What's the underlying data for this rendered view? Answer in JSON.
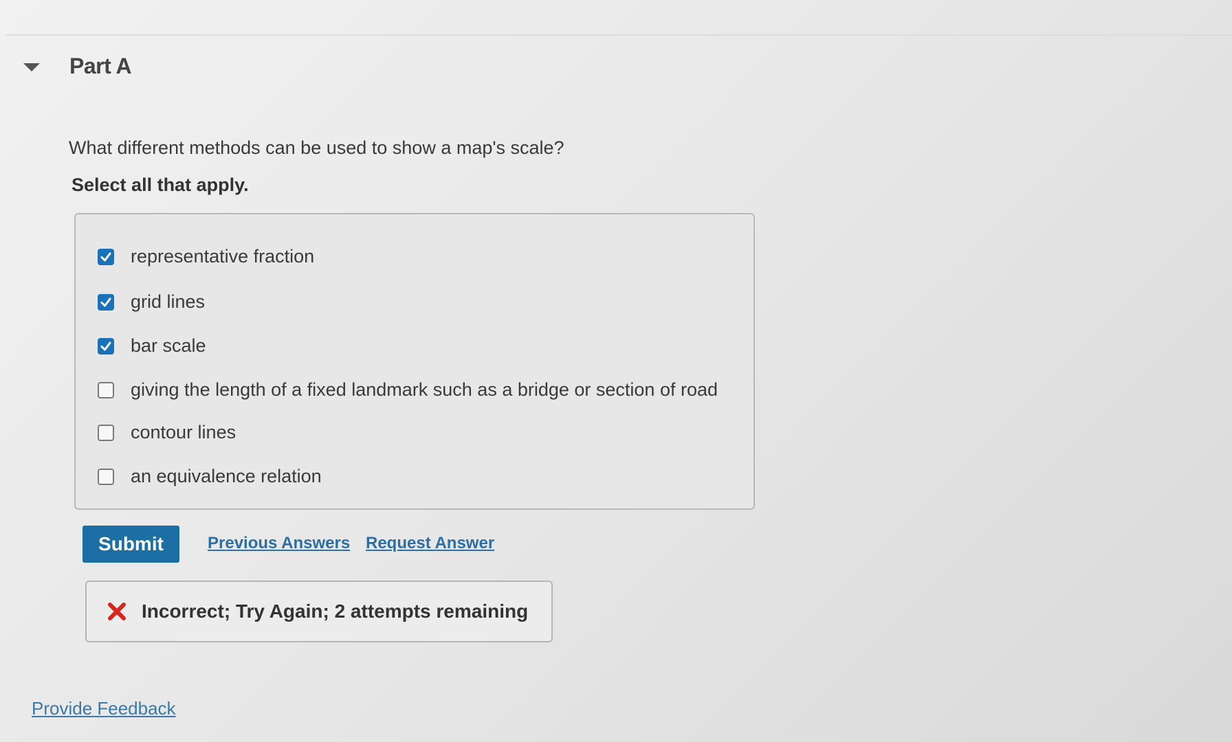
{
  "part": {
    "title": "Part A",
    "toggle_icon": "caret-down-icon"
  },
  "question": {
    "prompt": "What different methods can be used to show a map's scale?",
    "instruction": "Select all that apply."
  },
  "options": [
    {
      "label": "representative fraction",
      "checked": true
    },
    {
      "label": "grid lines",
      "checked": true
    },
    {
      "label": "bar scale",
      "checked": true
    },
    {
      "label": "giving the length of a fixed landmark such as a bridge or section of road",
      "checked": false
    },
    {
      "label": "contour lines",
      "checked": false
    },
    {
      "label": "an equivalence relation",
      "checked": false
    }
  ],
  "actions": {
    "submit_label": "Submit",
    "previous_answers_label": "Previous Answers",
    "request_answer_label": "Request Answer"
  },
  "feedback": {
    "icon": "x-mark-icon",
    "message": "Incorrect; Try Again; 2 attempts remaining"
  },
  "footer": {
    "provide_feedback_label": "Provide Feedback"
  },
  "colors": {
    "accent": "#1c6fa4",
    "checkbox_checked": "#1a73b9",
    "error": "#d9261c",
    "link": "#2b6fa3"
  }
}
